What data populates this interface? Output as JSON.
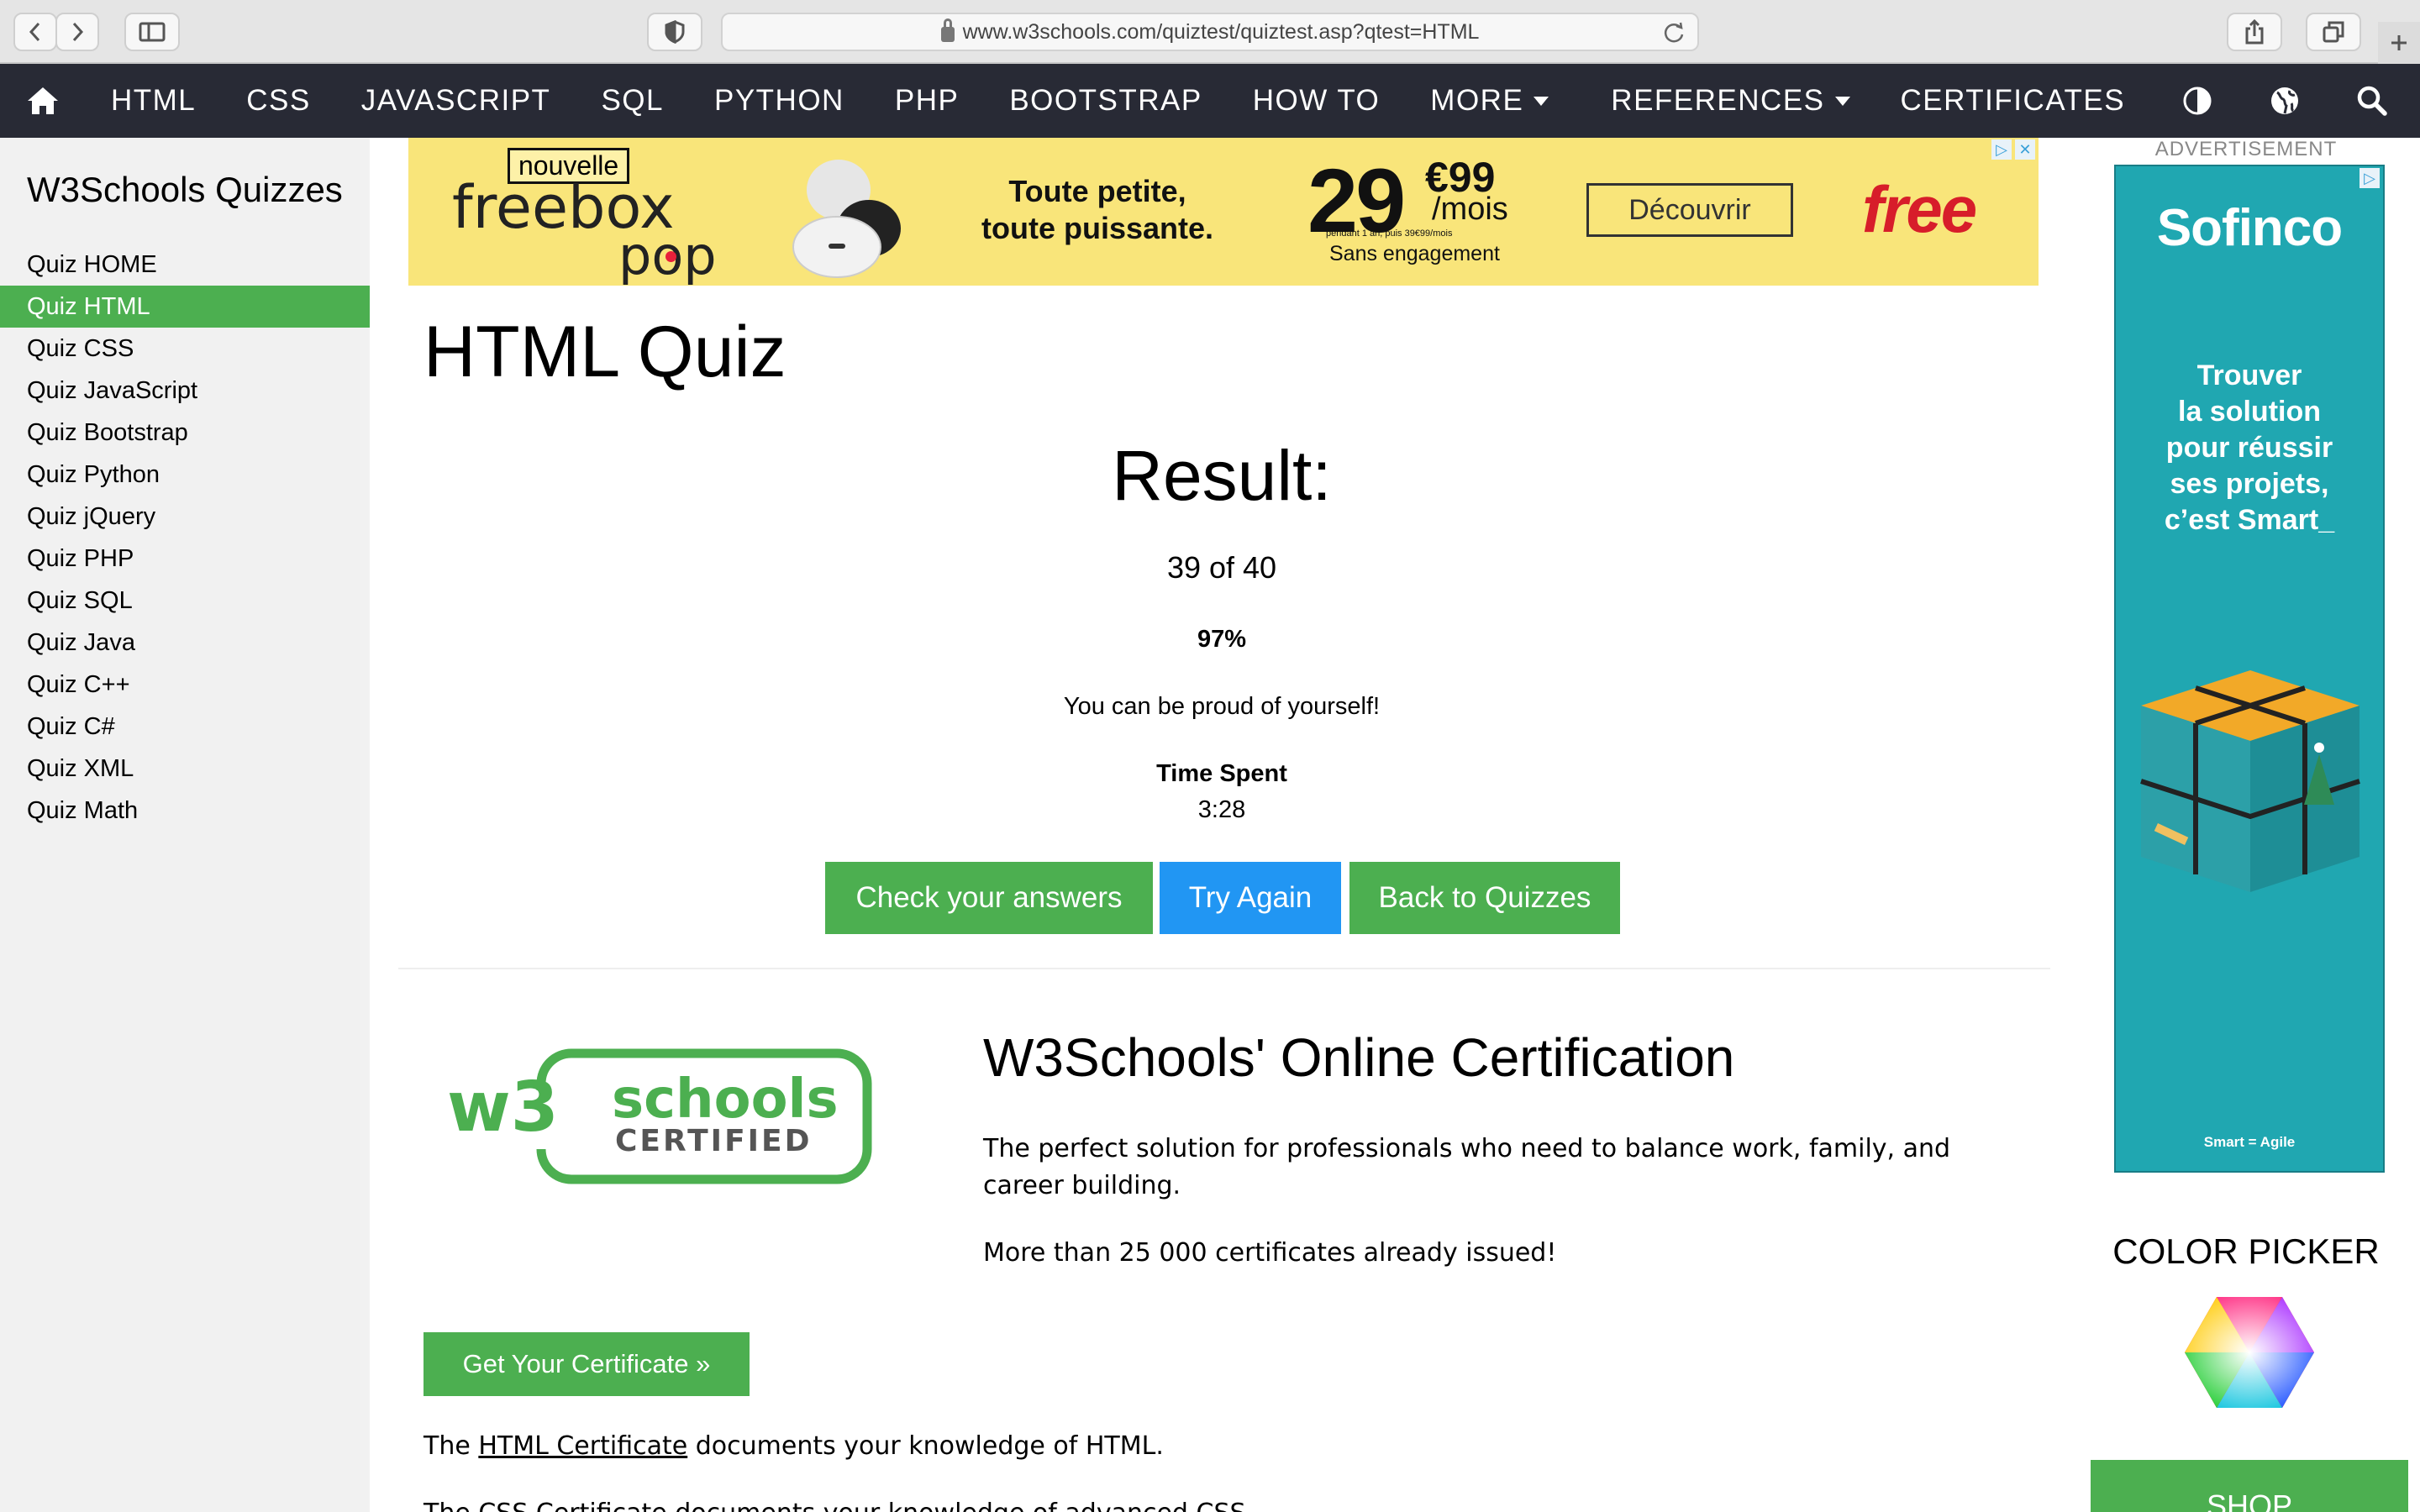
{
  "browser": {
    "url": "www.w3schools.com/quiztest/quiztest.asp?qtest=HTML"
  },
  "topnav": {
    "items": [
      {
        "label": "HTML"
      },
      {
        "label": "CSS"
      },
      {
        "label": "JAVASCRIPT"
      },
      {
        "label": "SQL"
      },
      {
        "label": "PYTHON"
      },
      {
        "label": "PHP"
      },
      {
        "label": "BOOTSTRAP"
      },
      {
        "label": "HOW TO"
      },
      {
        "label": "MORE"
      },
      {
        "label": "REFERENCES"
      },
      {
        "label": "CERTIFICATES"
      }
    ],
    "icons": [
      "home-icon",
      "contrast-icon",
      "globe-icon",
      "search-icon"
    ]
  },
  "sidebar": {
    "title": "W3Schools Quizzes",
    "items": [
      {
        "label": "Quiz HOME",
        "active": false
      },
      {
        "label": "Quiz HTML",
        "active": true
      },
      {
        "label": "Quiz CSS",
        "active": false
      },
      {
        "label": "Quiz JavaScript",
        "active": false
      },
      {
        "label": "Quiz Bootstrap",
        "active": false
      },
      {
        "label": "Quiz Python",
        "active": false
      },
      {
        "label": "Quiz jQuery",
        "active": false
      },
      {
        "label": "Quiz PHP",
        "active": false
      },
      {
        "label": "Quiz SQL",
        "active": false
      },
      {
        "label": "Quiz Java",
        "active": false
      },
      {
        "label": "Quiz C++",
        "active": false
      },
      {
        "label": "Quiz C#",
        "active": false
      },
      {
        "label": "Quiz XML",
        "active": false
      },
      {
        "label": "Quiz Math",
        "active": false
      }
    ]
  },
  "ad_banner": {
    "badge": "nouvelle",
    "brand_line1": "freebox",
    "brand_line2": "pop",
    "tagline_1": "Toute petite,",
    "tagline_2": "toute puissante.",
    "price": "29",
    "cents": "€99",
    "per": "/mois",
    "fine_print": "pendant 1 an, puis 39€99/mois",
    "commitment": "Sans engagement",
    "cta": "Découvrir",
    "logo": "free"
  },
  "main": {
    "title": "HTML Quiz",
    "result_title": "Result:",
    "score": "39 of 40",
    "percent": "97%",
    "message": "You can be proud of yourself!",
    "time_label": "Time Spent",
    "time_value": "3:28",
    "buttons": {
      "check": "Check your answers",
      "try_again": "Try Again",
      "back": "Back to Quizzes"
    },
    "colors": {
      "green": "#4caf50",
      "blue": "#2196f3"
    }
  },
  "certification": {
    "logo_text_1": "w3",
    "logo_text_2": "schools",
    "logo_text_3": "CERTIFIED",
    "title": "W3Schools' Online Certification",
    "description": "The perfect solution for professionals who need to balance work, family, and career building.",
    "count": "More than 25 000 certificates already issued!",
    "cta": "Get Your Certificate »",
    "html_line_pre": "The ",
    "html_line_link": "HTML Certificate",
    "html_line_post": " documents your knowledge of HTML.",
    "css_line": "The CSS Certificate documents your knowledge of advanced CSS."
  },
  "right_column": {
    "ad_label": "ADVERTISEMENT",
    "sofinco": {
      "logo": "Sofinco",
      "tagline": [
        "Trouver",
        "la solution",
        "pour réussir",
        "ses projets,",
        "c’est Smart_"
      ],
      "footer": "Smart = Agile"
    },
    "color_picker_title": "COLOR PICKER",
    "shop_label": "SHOP"
  }
}
